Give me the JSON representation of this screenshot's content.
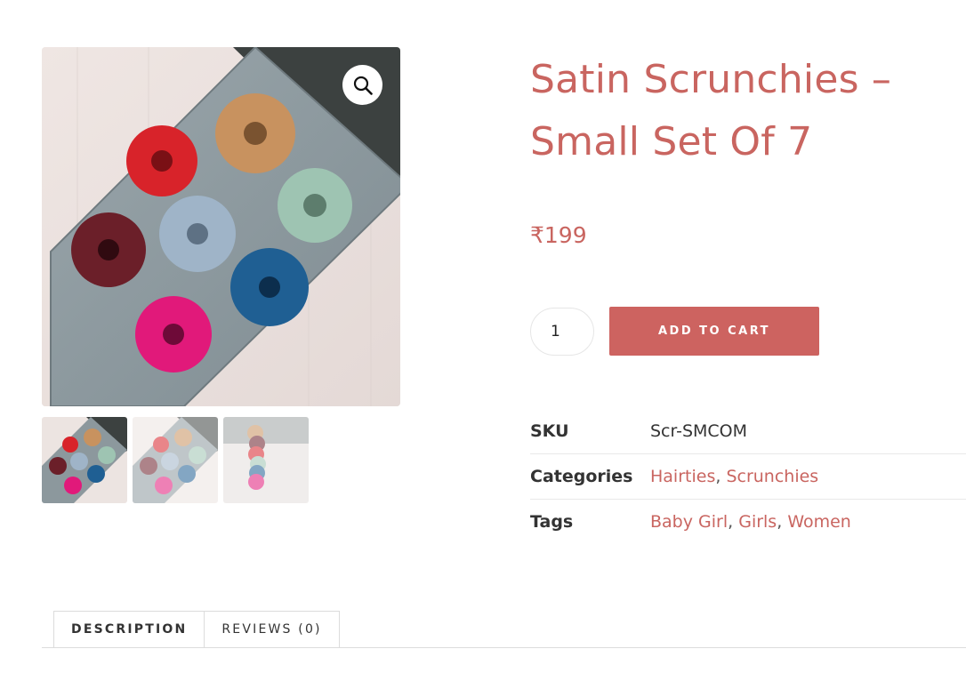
{
  "product": {
    "title": "Satin Scrunchies – Small Set Of 7",
    "price": "₹199",
    "quantity": "1",
    "add_to_cart_label": "ADD TO CART"
  },
  "meta": {
    "sku_label": "SKU",
    "sku_value": "Scr-SMCOM",
    "categories_label": "Categories",
    "categories": [
      "Hairties",
      "Scrunchies"
    ],
    "tags_label": "Tags",
    "tags": [
      "Baby Girl",
      "Girls",
      "Women"
    ]
  },
  "gallery": {
    "zoom_icon": "magnifier-icon",
    "thumbnail_count": 3
  },
  "tabs": [
    {
      "label": "DESCRIPTION",
      "active": true
    },
    {
      "label": "REVIEWS (0)",
      "active": false
    }
  ],
  "colors": {
    "accent": "#c96560",
    "button": "#cd6360",
    "scrunchie_colors": [
      "#d8232a",
      "#c8925f",
      "#9ec4b2",
      "#6b1f29",
      "#9fb4c8",
      "#1f5f93",
      "#e1197a"
    ]
  }
}
